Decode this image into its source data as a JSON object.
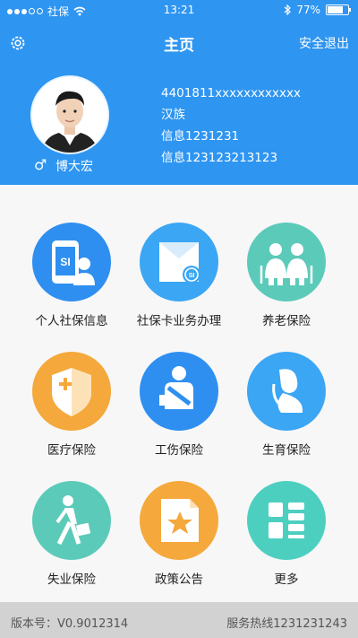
{
  "status_bar": {
    "carrier": "社保",
    "time": "13:21",
    "battery_text": "77%",
    "battery_level": 0.77
  },
  "header": {
    "title": "主页",
    "logout_label": "安全退出"
  },
  "profile": {
    "gender_symbol": "♂",
    "name": "博大宏",
    "id_number": "4401811xxxxxxxxxxxx",
    "ethnicity": "汉族",
    "info_line_1": "信息1231231",
    "info_line_2": "信息123123213123"
  },
  "tiles": [
    {
      "label": "个人社保信息",
      "icon": "phone-user-icon",
      "color": "#2e8ff0"
    },
    {
      "label": "社保卡业务办理",
      "icon": "social-card-icon",
      "color": "#3ba6f4"
    },
    {
      "label": "养老保险",
      "icon": "elderly-couple-icon",
      "color": "#5ccab9"
    },
    {
      "label": "医疗保险",
      "icon": "medical-shield-icon",
      "color": "#f5a83b"
    },
    {
      "label": "工伤保险",
      "icon": "injured-person-icon",
      "color": "#2e8ff0"
    },
    {
      "label": "生育保险",
      "icon": "pregnant-woman-icon",
      "color": "#3ba6f4"
    },
    {
      "label": "失业保险",
      "icon": "walking-person-icon",
      "color": "#5ccab9"
    },
    {
      "label": "政策公告",
      "icon": "star-document-icon",
      "color": "#f5a83b"
    },
    {
      "label": "更多",
      "icon": "more-grid-icon",
      "color": "#4dcfc0"
    }
  ],
  "footer": {
    "version": "版本号：V0.9012314",
    "hotline": "服务热线1231231243"
  }
}
